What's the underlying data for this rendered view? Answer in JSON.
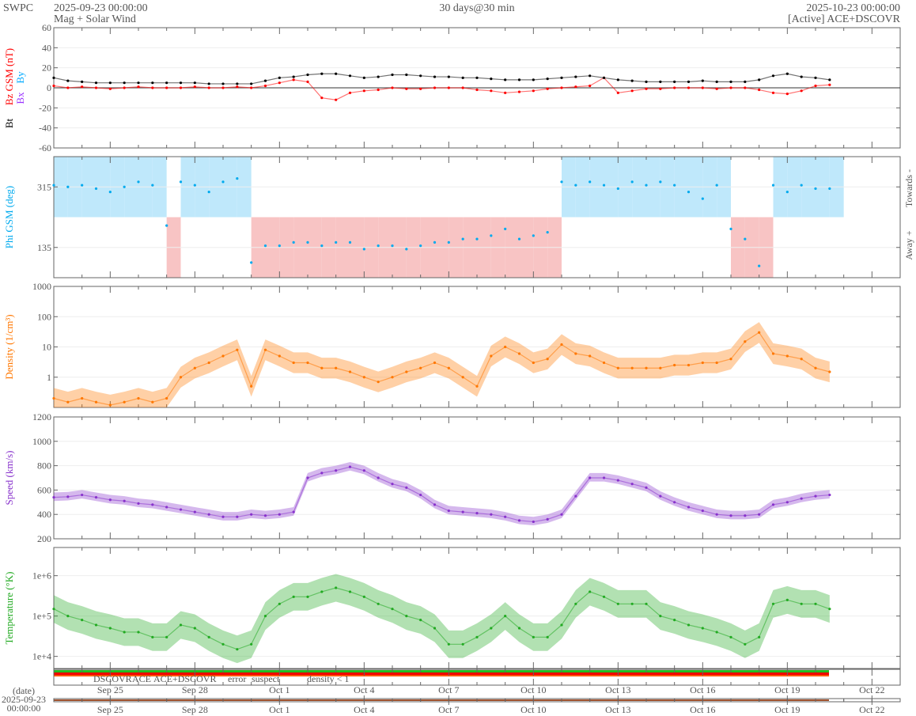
{
  "header": {
    "brand": "SWPC",
    "start_time": "2025-09-23 00:00:00",
    "subtitle": "Mag + Solar Wind",
    "range": "30 days@30 min",
    "end_time": "2025-10-23 00:00:00",
    "source": "[Active] ACE+DSCOVR"
  },
  "colors": {
    "bt": "#000000",
    "bz": "#ff0000",
    "bx": "#9933ff",
    "by": "#00aaff",
    "phi": "#00aaee",
    "towards_fill": "#bfe8fb",
    "away_fill": "#f8c4c4",
    "density": "#ff7700",
    "speed": "#8833cc",
    "temperature": "#22aa22"
  },
  "chart_data": [
    {
      "type": "line",
      "id": "mag",
      "ylabel_parts": [
        "Bt",
        "Bz GSM (nT)",
        "Bx",
        "By"
      ],
      "ylim": [
        -60,
        60
      ],
      "yticks": [
        "60",
        "40",
        "20",
        "0",
        "-20",
        "-40",
        "-60"
      ],
      "ytick_values": [
        60,
        40,
        20,
        0,
        -20,
        -40,
        -60
      ],
      "x_step_days": 0.5,
      "series": [
        {
          "name": "Bt",
          "values": [
            10,
            7,
            6,
            5,
            5,
            5,
            5,
            5,
            5,
            5,
            5,
            4,
            4,
            4,
            4,
            7,
            10,
            11,
            13,
            14,
            14,
            12,
            10,
            11,
            13,
            13,
            12,
            11,
            11,
            10,
            10,
            9,
            8,
            8,
            8,
            9,
            10,
            11,
            12,
            10,
            8,
            7,
            6,
            6,
            6,
            6,
            7,
            6,
            6,
            6,
            8,
            12,
            14,
            11,
            10,
            8
          ]
        },
        {
          "name": "Bz",
          "values": [
            2,
            0,
            1,
            0,
            -1,
            0,
            1,
            0,
            0,
            0,
            1,
            0,
            0,
            1,
            0,
            2,
            5,
            8,
            6,
            -10,
            -12,
            -5,
            -3,
            -2,
            0,
            -1,
            -1,
            0,
            0,
            0,
            -2,
            -3,
            -5,
            -4,
            -3,
            -1,
            0,
            1,
            2,
            10,
            -5,
            -3,
            -1,
            -1,
            0,
            0,
            0,
            -1,
            0,
            0,
            -2,
            -5,
            -6,
            -3,
            2,
            3
          ]
        }
      ]
    },
    {
      "type": "scatter",
      "id": "phi",
      "ylabel": "Phi GSM (deg)",
      "right_labels": [
        "Towards -",
        "Away +"
      ],
      "ylim": [
        45,
        405
      ],
      "yticks": [
        "315",
        "135"
      ],
      "ytick_values": [
        315,
        135
      ],
      "x_step_days": 0.5,
      "values": [
        320,
        315,
        320,
        310,
        300,
        315,
        330,
        320,
        200,
        330,
        320,
        300,
        330,
        340,
        90,
        140,
        140,
        150,
        150,
        140,
        150,
        150,
        130,
        140,
        140,
        130,
        140,
        150,
        150,
        160,
        160,
        170,
        190,
        160,
        170,
        180,
        330,
        320,
        330,
        320,
        310,
        330,
        320,
        330,
        320,
        300,
        280,
        320,
        190,
        160,
        80,
        320,
        300,
        320,
        310,
        310
      ]
    },
    {
      "type": "line",
      "id": "density",
      "scale": "log",
      "ylabel": "Density (1/cm³)",
      "ylim": [
        0.1,
        1000
      ],
      "yticks": [
        "1000",
        "100",
        "10",
        "1"
      ],
      "ytick_values": [
        1000,
        100,
        10,
        1
      ],
      "x_step_days": 0.5,
      "values": [
        0.2,
        0.15,
        0.2,
        0.15,
        0.12,
        0.15,
        0.2,
        0.15,
        0.2,
        1,
        2,
        3,
        5,
        8,
        0.5,
        8,
        5,
        3,
        3,
        2,
        2,
        1.5,
        1,
        0.7,
        1,
        1.5,
        2,
        3,
        2,
        1,
        0.5,
        5,
        10,
        6,
        3,
        4,
        12,
        6,
        5,
        3,
        2,
        2,
        2,
        2,
        2.5,
        2.5,
        3,
        3,
        4,
        15,
        30,
        6,
        5,
        4,
        2,
        1.5
      ]
    },
    {
      "type": "line",
      "id": "speed",
      "ylabel": "Speed (km/s)",
      "ylim": [
        200,
        1200
      ],
      "yticks": [
        "1200",
        "1000",
        "800",
        "600",
        "400",
        "200"
      ],
      "ytick_values": [
        1200,
        1000,
        800,
        600,
        400,
        200
      ],
      "x_step_days": 0.5,
      "values": [
        540,
        545,
        560,
        540,
        520,
        510,
        490,
        480,
        460,
        440,
        420,
        400,
        380,
        380,
        400,
        390,
        400,
        420,
        700,
        740,
        760,
        790,
        760,
        700,
        650,
        620,
        560,
        480,
        430,
        420,
        410,
        400,
        380,
        350,
        340,
        360,
        400,
        550,
        700,
        700,
        680,
        650,
        620,
        550,
        500,
        460,
        430,
        400,
        390,
        390,
        400,
        480,
        500,
        530,
        550,
        560
      ]
    },
    {
      "type": "line",
      "id": "temperature",
      "scale": "log",
      "ylabel": "Temperature (°K)",
      "ylim": [
        5000,
        5000000
      ],
      "yticks": [
        "1e+6",
        "1e+5",
        "1e+4"
      ],
      "ytick_values": [
        1000000,
        100000,
        10000
      ],
      "x_step_days": 0.5,
      "values": [
        150000,
        100000,
        80000,
        60000,
        50000,
        40000,
        40000,
        30000,
        30000,
        60000,
        50000,
        30000,
        20000,
        15000,
        20000,
        100000,
        200000,
        300000,
        300000,
        400000,
        500000,
        400000,
        300000,
        200000,
        150000,
        100000,
        80000,
        50000,
        20000,
        20000,
        30000,
        50000,
        100000,
        50000,
        30000,
        30000,
        60000,
        200000,
        400000,
        300000,
        200000,
        200000,
        200000,
        100000,
        80000,
        60000,
        50000,
        40000,
        30000,
        20000,
        30000,
        200000,
        250000,
        200000,
        200000,
        150000
      ]
    }
  ],
  "status_legend": [
    {
      "label": "DSCOVR",
      "color": "#0000ee"
    },
    {
      "label": "ACE",
      "color": "#22bb22"
    },
    {
      "label": "ACE+DSCOVR",
      "color": "#ee22cc"
    },
    {
      "label": "error",
      "color": "#ee0000"
    },
    {
      "label": "suspect",
      "color": "#eebb00"
    },
    {
      "label": "density < 1",
      "color": "#ff7700"
    }
  ],
  "x_axis": {
    "date_label": "(date)",
    "start_date": "2025-09-23",
    "start_time": "00:00:00",
    "tick_labels": [
      "Sep 25",
      "Sep 28",
      "Oct 1",
      "Oct 4",
      "Oct 7",
      "Oct 10",
      "Oct 13",
      "Oct 16",
      "Oct 19",
      "Oct 22"
    ],
    "tick_days": [
      2,
      5,
      8,
      11,
      14,
      17,
      20,
      23,
      26,
      29
    ],
    "total_days": 30
  }
}
